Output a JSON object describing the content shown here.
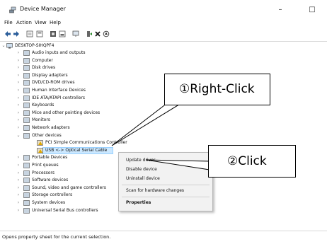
{
  "window": {
    "title": "Device Manager",
    "minimize_glyph": "–",
    "maximize_glyph": "□"
  },
  "menu": [
    "File",
    "Action",
    "View",
    "Help"
  ],
  "toolbar_icons": [
    "back-icon",
    "forward-icon",
    "properties-icon",
    "show-hide-icon",
    "help-icon",
    "view-icon",
    "monitor-icon",
    "update-driver-icon",
    "uninstall-icon",
    "scan-icon"
  ],
  "tree": {
    "root": "DESKTOP-SIHQPF4",
    "items": [
      {
        "label": "Audio inputs and outputs",
        "icon": "speaker-icon"
      },
      {
        "label": "Computer",
        "icon": "computer-icon"
      },
      {
        "label": "Disk drives",
        "icon": "disk-icon"
      },
      {
        "label": "Display adapters",
        "icon": "display-icon"
      },
      {
        "label": "DVD/CD-ROM drives",
        "icon": "dvd-icon"
      },
      {
        "label": "Human Interface Devices",
        "icon": "hid-icon"
      },
      {
        "label": "IDE ATA/ATAPI controllers",
        "icon": "ide-icon"
      },
      {
        "label": "Keyboards",
        "icon": "keyboard-icon"
      },
      {
        "label": "Mice and other pointing devices",
        "icon": "mouse-icon"
      },
      {
        "label": "Monitors",
        "icon": "monitor-icon"
      },
      {
        "label": "Network adapters",
        "icon": "network-icon"
      },
      {
        "label": "Other devices",
        "icon": "other-devices-icon"
      },
      {
        "label": "PCI Simple Communications Controller",
        "icon": "unknown-device-icon"
      },
      {
        "label": "USB <-> Optical Serial Cable",
        "icon": "unknown-device-icon"
      },
      {
        "label": "Portable Devices",
        "icon": "portable-icon"
      },
      {
        "label": "Print queues",
        "icon": "printer-icon"
      },
      {
        "label": "Processors",
        "icon": "processor-icon"
      },
      {
        "label": "Software devices",
        "icon": "software-icon"
      },
      {
        "label": "Sound, video and game controllers",
        "icon": "sound-icon"
      },
      {
        "label": "Storage controllers",
        "icon": "storage-icon"
      },
      {
        "label": "System devices",
        "icon": "system-icon"
      },
      {
        "label": "Universal Serial Bus controllers",
        "icon": "usb-icon"
      }
    ]
  },
  "context_menu": {
    "items": [
      "Update driver",
      "Disable device",
      "Uninstall device",
      "Scan for hardware changes",
      "Properties"
    ]
  },
  "callouts": {
    "right_click": "①Right-Click",
    "click": "②Click"
  },
  "status": "Opens property sheet for the current selection."
}
